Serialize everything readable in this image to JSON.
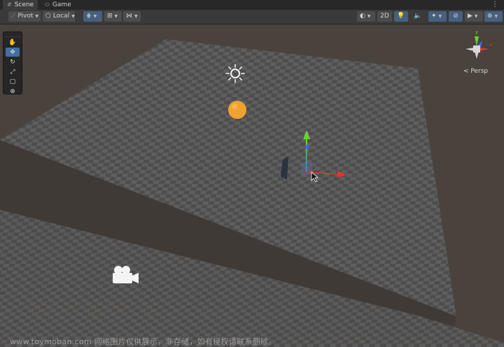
{
  "tabs": [
    {
      "label": "Scene",
      "icon": "hashtag-icon",
      "active": true
    },
    {
      "label": "Game",
      "icon": "gamepad-icon",
      "active": false
    }
  ],
  "tab_menu_glyph": "⋮",
  "toolbar": {
    "pivot_label": "Pivot",
    "local_label": "Local",
    "mode_2d_label": "2D"
  },
  "tools": [
    {
      "name": "hand-tool",
      "glyph": "✋",
      "active": false
    },
    {
      "name": "move-tool",
      "glyph": "✥",
      "active": true
    },
    {
      "name": "rotate-tool",
      "glyph": "↻",
      "active": false
    },
    {
      "name": "scale-tool",
      "glyph": "⤢",
      "active": false
    },
    {
      "name": "rect-tool",
      "glyph": "▢",
      "active": false
    },
    {
      "name": "transform-tool",
      "glyph": "⊕",
      "active": false
    }
  ],
  "gizmo": {
    "projection_label": "< Persp",
    "axis_y": "y",
    "axis_x": "x",
    "axis_z": "z"
  },
  "colors": {
    "x_axis": "#e0352f",
    "y_axis": "#6ad334",
    "z_axis": "#3b6be0",
    "sphere": "#f0a22e",
    "active_tool": "#3f6fa7"
  },
  "watermark": "www.toymoban.com 网络图片仅供展示，非存储，如有侵权请联系删除。"
}
